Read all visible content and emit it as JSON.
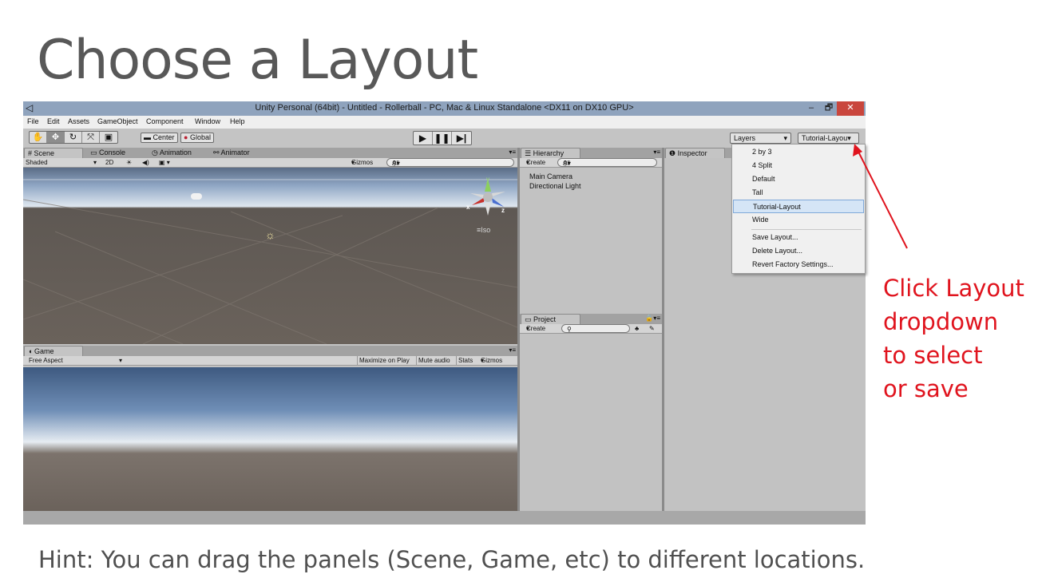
{
  "slide": {
    "title": "Choose a Layout",
    "hint": "Hint: You can drag the panels (Scene, Game, etc) to different locations.",
    "callout_lines": [
      "Click Layout",
      "dropdown",
      "to select",
      "or save"
    ]
  },
  "window": {
    "title": "Unity Personal (64bit) - Untitled - Rollerball - PC, Mac & Linux Standalone <DX11 on DX10 GPU>",
    "minimize": "–",
    "maximize": "🗗",
    "close": "✕"
  },
  "menubar": [
    "File",
    "Edit",
    "Assets",
    "GameObject",
    "Component",
    "Window",
    "Help"
  ],
  "toolbar": {
    "pivot": "Center",
    "space": "Global",
    "layers": "Layers",
    "layout": "Tutorial-Layou▾"
  },
  "scene": {
    "tabs": [
      "Scene",
      "Console",
      "Animation",
      "Animator"
    ],
    "shading": "Shaded",
    "mode2d": "2D",
    "gizmos": "Gizmos",
    "search_placeholder": "All",
    "iso": "Iso",
    "axis_y": "y",
    "axis_x": "x",
    "axis_z": "z"
  },
  "game": {
    "tab": "Game",
    "aspect": "Free Aspect",
    "maximize": "Maximize on Play",
    "mute": "Mute audio",
    "stats": "Stats",
    "gizmos": "Gizmos"
  },
  "hierarchy": {
    "tab": "Hierarchy",
    "create": "Create",
    "search_placeholder": "All",
    "items": [
      "Main Camera",
      "Directional Light"
    ]
  },
  "project": {
    "tab": "Project",
    "create": "Create"
  },
  "inspector": {
    "tab": "Inspector"
  },
  "layout_menu": {
    "items": [
      "2 by 3",
      "4 Split",
      "Default",
      "Tall",
      "Tutorial-Layout",
      "Wide"
    ],
    "selected": "Tutorial-Layout",
    "actions": [
      "Save Layout...",
      "Delete Layout...",
      "Revert Factory Settings..."
    ]
  },
  "colors": {
    "callout": "#e0141e",
    "arrow": "#e0141e"
  }
}
